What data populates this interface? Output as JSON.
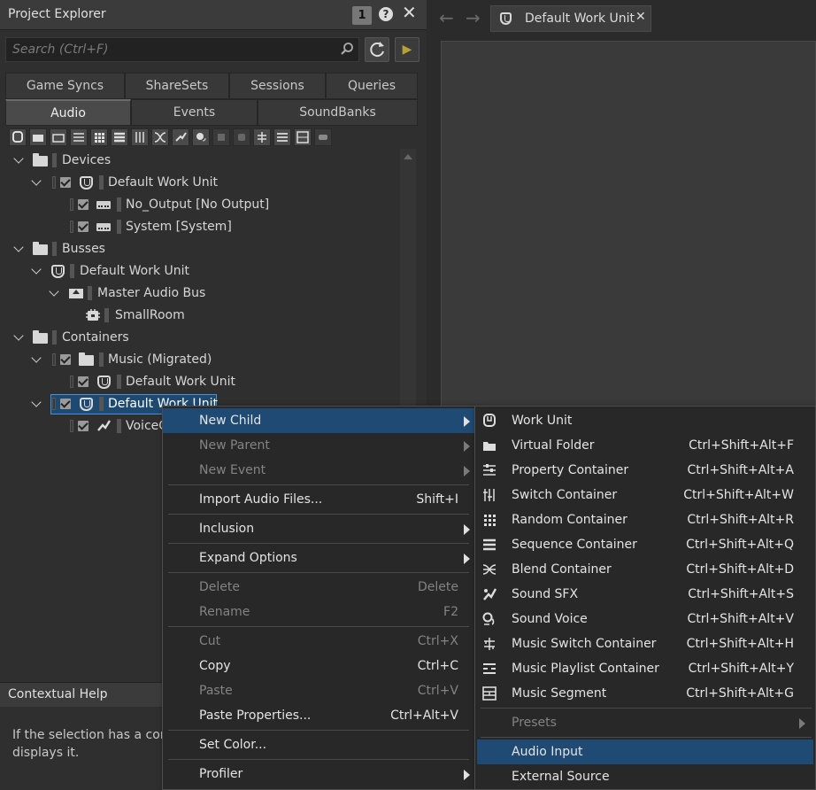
{
  "project_explorer": {
    "title": "Project Explorer",
    "badge": "1",
    "help_glyph": "?",
    "close_glyph": "✕",
    "search_placeholder": "Search (Ctrl+F)",
    "play_glyph": "▶",
    "tabs_row1": [
      "Game Syncs",
      "ShareSets",
      "Sessions",
      "Queries"
    ],
    "tabs_row2": [
      "Audio",
      "Events",
      "SoundBanks"
    ],
    "active_tab": "Audio"
  },
  "tree": {
    "devices": "Devices",
    "devices_wu": "Default Work Unit",
    "no_output": "No_Output [No Output]",
    "system": "System [System]",
    "busses": "Busses",
    "busses_wu": "Default Work Unit",
    "master_bus": "Master Audio Bus",
    "small_room": "SmallRoom",
    "containers": "Containers",
    "music_migrated": "Music (Migrated)",
    "music_wu": "Default Work Unit",
    "selected_wu": "Default Work Unit",
    "voice_item": "VoiceC"
  },
  "contextual_help": {
    "title": "Contextual Help",
    "body_line1": "If the selection has a corre",
    "body_line2": "displays it."
  },
  "document": {
    "back_glyph": "←",
    "forward_glyph": "→",
    "tab_label": "Default Work Unit",
    "tab_close": "✕"
  },
  "context_menu": {
    "new_child": "New Child",
    "new_parent": "New Parent",
    "new_event": "New Event",
    "import_audio": "Import Audio Files...",
    "import_audio_sc": "Shift+I",
    "inclusion": "Inclusion",
    "expand_options": "Expand Options",
    "delete": "Delete",
    "delete_sc": "Delete",
    "rename": "Rename",
    "rename_sc": "F2",
    "cut": "Cut",
    "cut_sc": "Ctrl+X",
    "copy": "Copy",
    "copy_sc": "Ctrl+C",
    "paste": "Paste",
    "paste_sc": "Ctrl+V",
    "paste_properties": "Paste Properties...",
    "paste_properties_sc": "Ctrl+Alt+V",
    "set_color": "Set Color...",
    "profiler": "Profiler"
  },
  "submenu": {
    "work_unit": "Work Unit",
    "virtual_folder": "Virtual Folder",
    "virtual_folder_sc": "Ctrl+Shift+Alt+F",
    "property_container": "Property Container",
    "property_container_sc": "Ctrl+Shift+Alt+A",
    "switch_container": "Switch Container",
    "switch_container_sc": "Ctrl+Shift+Alt+W",
    "random_container": "Random Container",
    "random_container_sc": "Ctrl+Shift+Alt+R",
    "sequence_container": "Sequence Container",
    "sequence_container_sc": "Ctrl+Shift+Alt+Q",
    "blend_container": "Blend Container",
    "blend_container_sc": "Ctrl+Shift+Alt+D",
    "sound_sfx": "Sound SFX",
    "sound_sfx_sc": "Ctrl+Shift+Alt+S",
    "sound_voice": "Sound Voice",
    "sound_voice_sc": "Ctrl+Shift+Alt+V",
    "music_switch": "Music Switch Container",
    "music_switch_sc": "Ctrl+Shift+Alt+H",
    "music_playlist": "Music Playlist Container",
    "music_playlist_sc": "Ctrl+Shift+Alt+Y",
    "music_segment": "Music Segment",
    "music_segment_sc": "Ctrl+Shift+Alt+G",
    "presets": "Presets",
    "audio_input": "Audio Input",
    "external_source": "External Source"
  },
  "colors": {
    "highlight": "#1f4a73",
    "selection_border": "#4a8fd4",
    "accent_play": "#b7a03a"
  }
}
